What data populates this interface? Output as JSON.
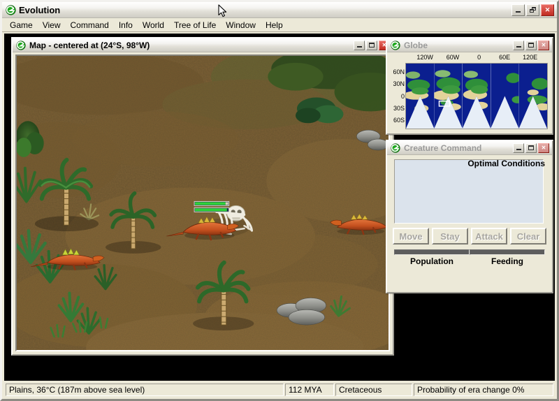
{
  "app": {
    "title": "Evolution",
    "icon": "evolution-e-icon"
  },
  "window_buttons": {
    "minimize": "minimize-icon",
    "maximize": "maximize-icon",
    "restore": "restore-icon",
    "close": "close-icon",
    "close_glyph": "✕"
  },
  "menu": {
    "items": [
      {
        "label": "Game"
      },
      {
        "label": "View"
      },
      {
        "label": "Command"
      },
      {
        "label": "Info"
      },
      {
        "label": "World"
      },
      {
        "label": "Tree of Life"
      },
      {
        "label": "Window"
      },
      {
        "label": "Help"
      }
    ]
  },
  "map_window": {
    "title": "Map - centered at (24°S, 98°W)",
    "active": true
  },
  "globe_window": {
    "title": "Globe",
    "active": false,
    "lon_labels": [
      "120W",
      "60W",
      "0",
      "60E",
      "120E"
    ],
    "lat_labels": [
      "60N",
      "30N",
      "0",
      "30S",
      "60S"
    ],
    "viewport_marker": "current-view-rectangle"
  },
  "creature_window": {
    "title": "Creature Command",
    "active": false,
    "optimal_conditions_label": "Optimal Conditions",
    "buttons": [
      {
        "label": "Move",
        "enabled": false
      },
      {
        "label": "Stay",
        "enabled": false
      },
      {
        "label": "Attack",
        "enabled": false
      },
      {
        "label": "Clear",
        "enabled": false
      }
    ],
    "meters": [
      {
        "label": "Population",
        "value": 0
      },
      {
        "label": "Feeding",
        "value": 0
      }
    ]
  },
  "status_bar": {
    "terrain_info": "Plains, 36°C (187m above sea level)",
    "time_mya": "112 MYA",
    "era": "Cretaceous",
    "era_change": "Probability of era change 0%"
  },
  "colors": {
    "desktop": "#000000",
    "face": "#ece9d8",
    "title_active_text": "#000000",
    "title_inactive_text": "#9a9a9a",
    "close_button": "#c02c22",
    "terrain_sand": "#8a6a3b",
    "terrain_grass": "#4a6b2c",
    "ocean": "#0b1f8f",
    "land_green": "#2f8f3a",
    "land_tan": "#e3d39a",
    "creature_red": "#c4501e",
    "health_bar": "#2fd23a",
    "panel_display": "#dbe3ec"
  }
}
